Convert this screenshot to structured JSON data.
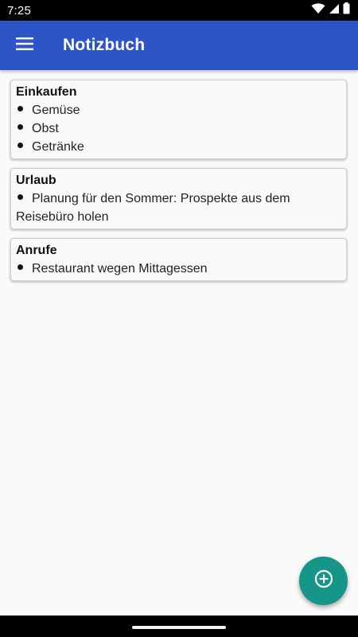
{
  "status_bar": {
    "time": "7:25",
    "icons": [
      "wifi-icon",
      "signal-icon",
      "battery-icon"
    ]
  },
  "app_bar": {
    "menu_icon": "menu-icon",
    "title": "Notizbuch",
    "background_color": "#2d55c8"
  },
  "notes": [
    {
      "title": "Einkaufen",
      "items": [
        "Gemüse",
        "Obst",
        "Getränke"
      ]
    },
    {
      "title": "Urlaub",
      "items": [
        "Planung für den Sommer: Prospekte aus dem Reisebüro holen"
      ]
    },
    {
      "title": "Anrufe",
      "items": [
        "Restaurant wegen Mittagessen"
      ]
    }
  ],
  "fab": {
    "icon": "add-circle-icon",
    "color": "#159688"
  }
}
